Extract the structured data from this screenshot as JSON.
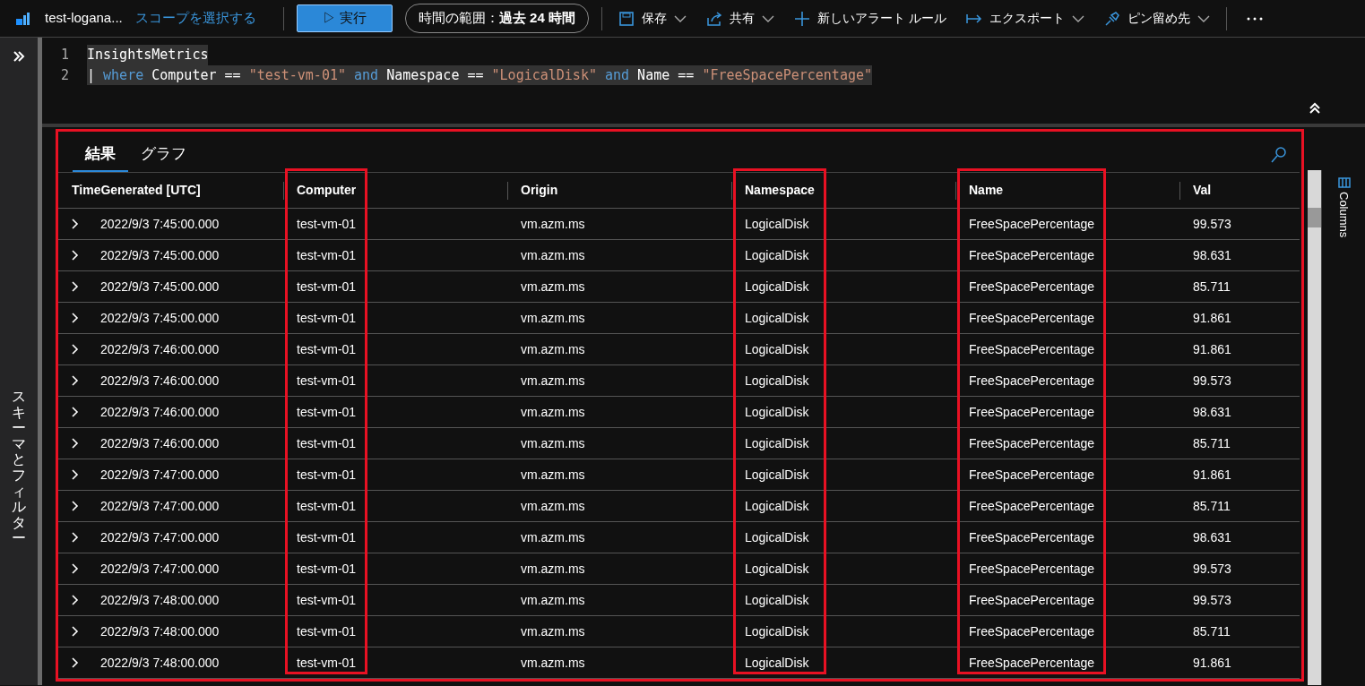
{
  "header": {
    "workspace": "test-logana...",
    "scope_link": "スコープを選択する",
    "run_button": "▷ 実行",
    "time_range": {
      "label": "時間の範囲：",
      "value": "過去 24 時間"
    },
    "actions": [
      {
        "kind": "save",
        "label": "保存",
        "dropdown": true
      },
      {
        "kind": "share",
        "label": "共有",
        "dropdown": true
      },
      {
        "kind": "alert",
        "label": "新しいアラート ルール",
        "dropdown": false
      },
      {
        "kind": "export",
        "label": "エクスポート",
        "dropdown": true
      },
      {
        "kind": "pin",
        "label": "ピン留め先",
        "dropdown": true
      }
    ]
  },
  "sidebar": {
    "label": "スキーマとフィルター"
  },
  "editor": {
    "lines": [
      {
        "number": "1",
        "tokens": [
          {
            "kind": "plain",
            "text": "InsightsMetrics"
          }
        ]
      },
      {
        "number": "2",
        "tokens": [
          {
            "kind": "plain",
            "text": "| "
          },
          {
            "kind": "keyword",
            "text": "where"
          },
          {
            "kind": "plain",
            "text": " Computer == "
          },
          {
            "kind": "string",
            "text": "\"test-vm-01\" "
          },
          {
            "kind": "keyword",
            "text": "and"
          },
          {
            "kind": "plain",
            "text": " Namespace == "
          },
          {
            "kind": "string",
            "text": "\"LogicalDisk\" "
          },
          {
            "kind": "keyword",
            "text": "and"
          },
          {
            "kind": "plain",
            "text": " Name == "
          },
          {
            "kind": "string",
            "text": "\"FreeSpacePercentage\""
          }
        ]
      }
    ]
  },
  "results": {
    "highlighted": true,
    "tabs": [
      {
        "label": "結果",
        "selected": true
      },
      {
        "label": "グラフ",
        "selected": false
      }
    ],
    "columns": [
      {
        "label": "TimeGenerated [UTC]",
        "highlighted": false
      },
      {
        "label": "Computer",
        "highlighted": true
      },
      {
        "label": "Origin",
        "highlighted": false
      },
      {
        "label": "Namespace",
        "highlighted": true
      },
      {
        "label": "Name",
        "highlighted": true
      },
      {
        "label": "Val",
        "highlighted": false
      }
    ],
    "rows": [
      [
        "2022/9/3 7:45:00.000",
        "test-vm-01",
        "vm.azm.ms",
        "LogicalDisk",
        "FreeSpacePercentage",
        "99.573"
      ],
      [
        "2022/9/3 7:45:00.000",
        "test-vm-01",
        "vm.azm.ms",
        "LogicalDisk",
        "FreeSpacePercentage",
        "98.631"
      ],
      [
        "2022/9/3 7:45:00.000",
        "test-vm-01",
        "vm.azm.ms",
        "LogicalDisk",
        "FreeSpacePercentage",
        "85.711"
      ],
      [
        "2022/9/3 7:45:00.000",
        "test-vm-01",
        "vm.azm.ms",
        "LogicalDisk",
        "FreeSpacePercentage",
        "91.861"
      ],
      [
        "2022/9/3 7:46:00.000",
        "test-vm-01",
        "vm.azm.ms",
        "LogicalDisk",
        "FreeSpacePercentage",
        "91.861"
      ],
      [
        "2022/9/3 7:46:00.000",
        "test-vm-01",
        "vm.azm.ms",
        "LogicalDisk",
        "FreeSpacePercentage",
        "99.573"
      ],
      [
        "2022/9/3 7:46:00.000",
        "test-vm-01",
        "vm.azm.ms",
        "LogicalDisk",
        "FreeSpacePercentage",
        "98.631"
      ],
      [
        "2022/9/3 7:46:00.000",
        "test-vm-01",
        "vm.azm.ms",
        "LogicalDisk",
        "FreeSpacePercentage",
        "85.711"
      ],
      [
        "2022/9/3 7:47:00.000",
        "test-vm-01",
        "vm.azm.ms",
        "LogicalDisk",
        "FreeSpacePercentage",
        "91.861"
      ],
      [
        "2022/9/3 7:47:00.000",
        "test-vm-01",
        "vm.azm.ms",
        "LogicalDisk",
        "FreeSpacePercentage",
        "85.711"
      ],
      [
        "2022/9/3 7:47:00.000",
        "test-vm-01",
        "vm.azm.ms",
        "LogicalDisk",
        "FreeSpacePercentage",
        "98.631"
      ],
      [
        "2022/9/3 7:47:00.000",
        "test-vm-01",
        "vm.azm.ms",
        "LogicalDisk",
        "FreeSpacePercentage",
        "99.573"
      ],
      [
        "2022/9/3 7:48:00.000",
        "test-vm-01",
        "vm.azm.ms",
        "LogicalDisk",
        "FreeSpacePercentage",
        "99.573"
      ],
      [
        "2022/9/3 7:48:00.000",
        "test-vm-01",
        "vm.azm.ms",
        "LogicalDisk",
        "FreeSpacePercentage",
        "85.711"
      ],
      [
        "2022/9/3 7:48:00.000",
        "test-vm-01",
        "vm.azm.ms",
        "LogicalDisk",
        "FreeSpacePercentage",
        "91.861"
      ]
    ],
    "columns_panel": "Columns"
  }
}
